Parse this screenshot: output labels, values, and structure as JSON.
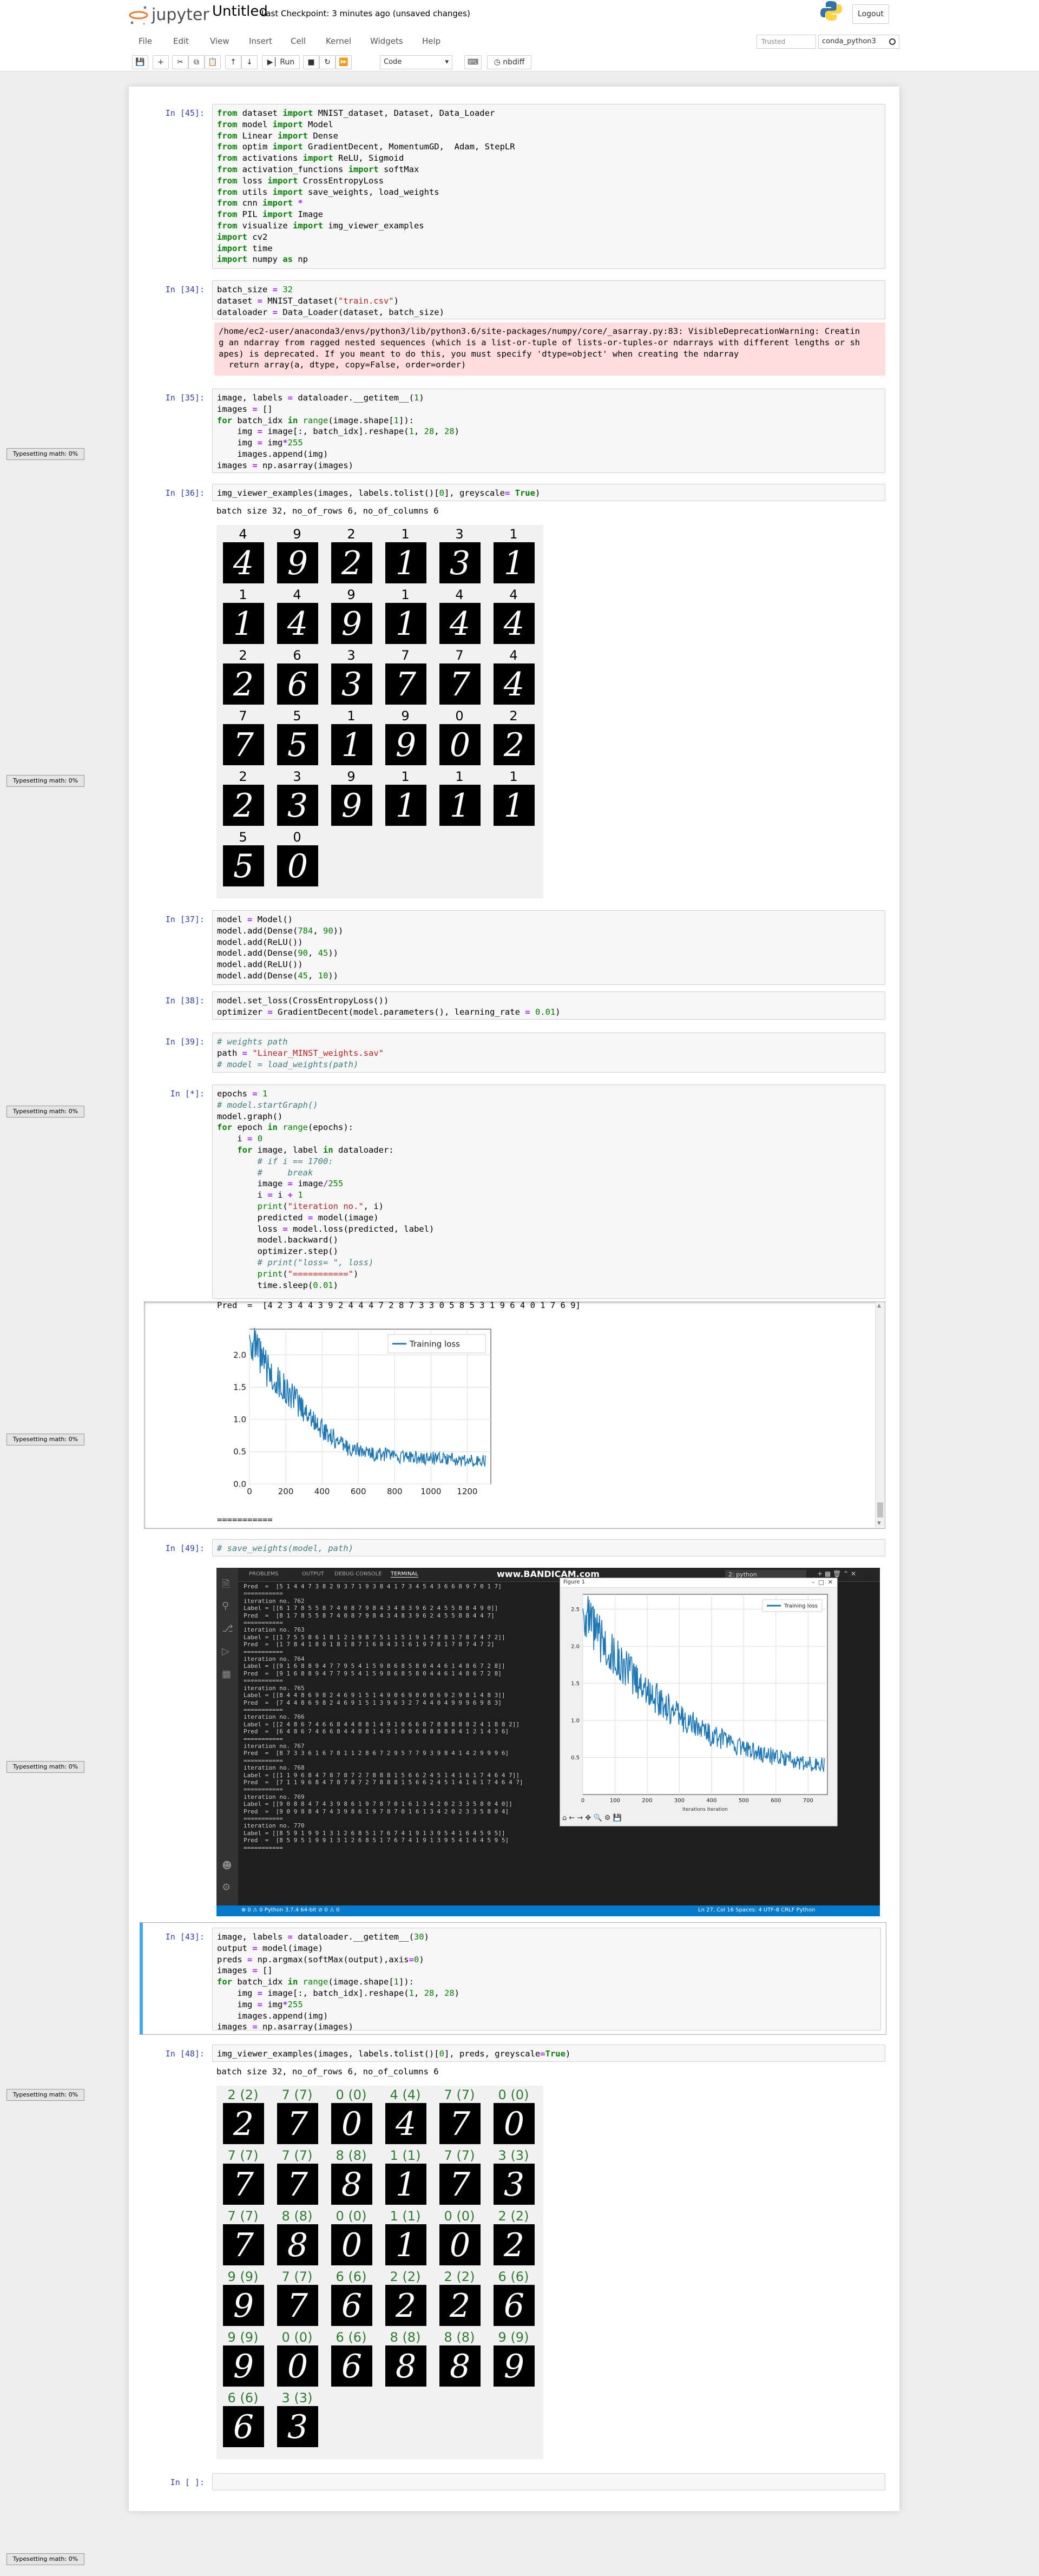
{
  "header": {
    "logo_text": "jupyter",
    "notebook_name": "Untitled",
    "checkpoint": "Last Checkpoint: 3 minutes ago  (unsaved changes)",
    "logout": "Logout",
    "trusted": "Trusted",
    "kernel": "conda_python3",
    "menu": [
      "File",
      "Edit",
      "View",
      "Insert",
      "Cell",
      "Kernel",
      "Widgets",
      "Help"
    ],
    "toolbar": {
      "run": "Run",
      "cell_type": "Code",
      "nbdiff": "nbdiff"
    }
  },
  "typesetting": "Typesetting math: 0%",
  "cells": {
    "c45": {
      "prompt": "In [45]:",
      "code": [
        "from dataset import MNIST_dataset, Dataset, Data_Loader",
        "from model import Model",
        "from Linear import Dense",
        "from optim import GradientDecent, MomentumGD,  Adam, StepLR",
        "from activations import ReLU, Sigmoid",
        "from activation_functions import softMax",
        "from loss import CrossEntropyLoss",
        "from utils import save_weights, load_weights",
        "from cnn import *",
        "from PIL import Image",
        "from visualize import img_viewer_examples",
        "import cv2",
        "import time",
        "import numpy as np"
      ]
    },
    "c34": {
      "prompt": "In [34]:",
      "code": [
        "batch_size = 32",
        "dataset = MNIST_dataset(\"train.csv\")",
        "dataloader = Data_Loader(dataset, batch_size)"
      ],
      "stderr": [
        "/home/ec2-user/anaconda3/envs/python3/lib/python3.6/site-packages/numpy/core/_asarray.py:83: VisibleDeprecationWarning: Creatin",
        "g an ndarray from ragged nested sequences (which is a list-or-tuple of lists-or-tuples-or ndarrays with different lengths or sh",
        "apes) is deprecated. If you meant to do this, you must specify 'dtype=object' when creating the ndarray",
        "  return array(a, dtype, copy=False, order=order)"
      ]
    },
    "c35": {
      "prompt": "In [35]:",
      "code": [
        "image, labels = dataloader.__getitem__(1)",
        "images = []",
        "for batch_idx in range(image.shape[1]):",
        "    img = image[:, batch_idx].reshape(1, 28, 28)",
        "    img = img*255",
        "    images.append(img)",
        "images = np.asarray(images)"
      ]
    },
    "c36": {
      "prompt": "In [36]:",
      "code": [
        "img_viewer_examples(images, labels.tolist()[0], greyscale= True)"
      ],
      "output": "batch size 32, no_of_rows 6, no_of_columns 6",
      "grid": [
        [
          "4",
          "4"
        ],
        [
          "9",
          "9"
        ],
        [
          "2",
          "2"
        ],
        [
          "1",
          "1"
        ],
        [
          "3",
          "3"
        ],
        [
          "1",
          "1"
        ],
        [
          "1",
          "1"
        ],
        [
          "4",
          "4"
        ],
        [
          "9",
          "9"
        ],
        [
          "1",
          "1"
        ],
        [
          "4",
          "4"
        ],
        [
          "4",
          "4"
        ],
        [
          "2",
          "2"
        ],
        [
          "6",
          "6"
        ],
        [
          "3",
          "3"
        ],
        [
          "7",
          "7"
        ],
        [
          "7",
          "7"
        ],
        [
          "4",
          "4"
        ],
        [
          "7",
          "7"
        ],
        [
          "5",
          "5"
        ],
        [
          "1",
          "1"
        ],
        [
          "9",
          "9"
        ],
        [
          "0",
          "0"
        ],
        [
          "2",
          "2"
        ],
        [
          "2",
          "2"
        ],
        [
          "3",
          "3"
        ],
        [
          "9",
          "9"
        ],
        [
          "1",
          "1"
        ],
        [
          "1",
          "1"
        ],
        [
          "1",
          "1"
        ],
        [
          "5",
          "5"
        ],
        [
          "0",
          "0"
        ]
      ]
    },
    "c37": {
      "prompt": "In [37]:",
      "code": [
        "model = Model()",
        "model.add(Dense(784, 90))",
        "model.add(ReLU())",
        "model.add(Dense(90, 45))",
        "model.add(ReLU())",
        "model.add(Dense(45, 10))"
      ]
    },
    "c38": {
      "prompt": "In [38]:",
      "code": [
        "model.set_loss(CrossEntropyLoss())",
        "optimizer = GradientDecent(model.parameters(), learning_rate = 0.01)"
      ]
    },
    "c39": {
      "prompt": "In [39]:",
      "code": [
        "# weights path",
        "path = \"Linear_MINST_weights.sav\"",
        "# model = load_weights(path)"
      ]
    },
    "cstar": {
      "prompt": "In [*]:",
      "code": [
        "epochs = 1",
        "# model.startGraph()",
        "model.graph()",
        "for epoch in range(epochs):",
        "    i = 0",
        "    for image, label in dataloader:",
        "        # if i == 1700:",
        "        #     break",
        "        image = image/255",
        "        i = i + 1",
        "        print(\"iteration no.\", i)",
        "        predicted = model(image)",
        "        loss = model.loss(predicted, label)",
        "        model.backward()",
        "        optimizer.step()",
        "        # print(\"loss= \", loss)",
        "        print(\"===========\")",
        "        time.sleep(0.01)"
      ],
      "out_top": "Pred  =  [4 2 3 4 4 3 9 2 4 4 4 7 2 8 7 3 3 0 5 8 5 3 1 9 6 4 0 1 7 6 9]",
      "out_bottom": "==========="
    },
    "c49": {
      "prompt": "In [49]:",
      "code": [
        "# save_weights(model, path)"
      ]
    },
    "c43": {
      "prompt": "In [43]:",
      "code": [
        "image, labels = dataloader.__getitem__(30)",
        "output = model(image)",
        "preds = np.argmax(softMax(output),axis=0)",
        "images = []",
        "for batch_idx in range(image.shape[1]):",
        "    img = image[:, batch_idx].reshape(1, 28, 28)",
        "    img = img*255",
        "    images.append(img)",
        "images = np.asarray(images)"
      ]
    },
    "c48": {
      "prompt": "In [48]:",
      "code": [
        "img_viewer_examples(images, labels.tolist()[0], preds, greyscale=True)"
      ],
      "output": "batch size 32, no_of_rows 6, no_of_columns 6",
      "grid": [
        [
          "2 (2)",
          "2"
        ],
        [
          "7 (7)",
          "7"
        ],
        [
          "0 (0)",
          "0"
        ],
        [
          "4 (4)",
          "4"
        ],
        [
          "7 (7)",
          "7"
        ],
        [
          "0 (0)",
          "0"
        ],
        [
          "7 (7)",
          "7"
        ],
        [
          "7 (7)",
          "7"
        ],
        [
          "8 (8)",
          "8"
        ],
        [
          "1 (1)",
          "1"
        ],
        [
          "7 (7)",
          "7"
        ],
        [
          "3 (3)",
          "3"
        ],
        [
          "7 (7)",
          "7"
        ],
        [
          "8 (8)",
          "8"
        ],
        [
          "0 (0)",
          "0"
        ],
        [
          "1 (1)",
          "1"
        ],
        [
          "0 (0)",
          "0"
        ],
        [
          "2 (2)",
          "2"
        ],
        [
          "9 (9)",
          "9"
        ],
        [
          "7 (7)",
          "7"
        ],
        [
          "6 (6)",
          "6"
        ],
        [
          "2 (2)",
          "2"
        ],
        [
          "2 (2)",
          "2"
        ],
        [
          "6 (6)",
          "6"
        ],
        [
          "9 (9)",
          "9"
        ],
        [
          "0 (0)",
          "0"
        ],
        [
          "6 (6)",
          "6"
        ],
        [
          "8 (8)",
          "8"
        ],
        [
          "8 (8)",
          "8"
        ],
        [
          "9 (9)",
          "9"
        ],
        [
          "6 (6)",
          "6"
        ],
        [
          "3 (3)",
          "3"
        ]
      ]
    },
    "cempty": {
      "prompt": "In [ ]:"
    }
  },
  "chart_data": [
    {
      "type": "line",
      "title": "",
      "series": [
        {
          "name": "Training loss",
          "color": "#1f77b4"
        }
      ],
      "x": [
        0,
        20,
        40,
        60,
        80,
        100,
        150,
        200,
        250,
        300,
        350,
        400,
        450,
        500,
        550,
        600,
        650,
        700,
        750,
        800,
        850,
        900,
        950,
        1000,
        1050,
        1100,
        1150,
        1200,
        1250,
        1300
      ],
      "y": [
        2.3,
        2.15,
        2.05,
        1.95,
        1.85,
        1.75,
        1.6,
        1.45,
        1.3,
        1.15,
        1.0,
        0.85,
        0.75,
        0.62,
        0.55,
        0.52,
        0.48,
        0.46,
        0.45,
        0.43,
        0.42,
        0.41,
        0.4,
        0.4,
        0.39,
        0.38,
        0.37,
        0.37,
        0.36,
        0.36
      ],
      "xticks": [
        "0",
        "200",
        "400",
        "600",
        "800",
        "1000",
        "1200"
      ],
      "yticks": [
        "0.0",
        "0.5",
        "1.0",
        "1.5",
        "2.0"
      ],
      "xlim": [
        0,
        1330
      ],
      "ylim": [
        0,
        2.4
      ],
      "legend": "top-right",
      "grid": true
    }
  ],
  "screenshot": {
    "watermark": "www.BANDICAM.com",
    "panel_tabs": [
      "PROBLEMS",
      "OUTPUT",
      "DEBUG CONSOLE",
      "TERMINAL"
    ],
    "terminal_select": "2: python",
    "figure_title": "Figure 1",
    "figure_legend": "Training loss",
    "figure_xlabel": "Iterations Iteration",
    "figure_yticks": [
      "0.5",
      "1.0",
      "1.5",
      "2.0",
      "2.5"
    ],
    "figure_xticks": [
      "0",
      "100",
      "200",
      "300",
      "400",
      "500",
      "600",
      "700"
    ],
    "status_left": "⊗ 0 ⚠ 0   Python 3.7.4 64-bit   ⊘ 0 ⚠ 0",
    "status_right": "Ln 27, Col 16   Spaces: 4   UTF-8   CRLF   Python",
    "terminal_lines": [
      "Pred  =  [5 1 4 4 7 3 8 2 9 3 7 1 9 3 8 4 1 7 3 4 5 4 3 6 6 8 9 7 0 1 7]",
      "===========",
      "iteration no. 762",
      "Label = [[6 1 7 8 5 5 8 7 4 0 8 7 9 8 4 3 4 8 3 9 6 2 4 5 5 8 8 4 9 0]]",
      "Pred  =  [8 1 7 8 5 5 8 7 4 0 8 7 9 8 4 3 4 8 3 9 6 2 4 5 5 8 8 4 4 7]",
      "===========",
      "iteration no. 763",
      "Label = [[1 7 5 5 8 6 1 8 1 2 1 9 8 7 5 1 1 5 1 9 1 4 7 8 1 7 8 7 4 7 2]]",
      "Pred  =  [1 7 8 4 1 8 0 1 8 1 8 7 1 6 8 4 3 1 6 1 9 7 8 1 7 8 7 4 7 2]",
      "===========",
      "iteration no. 764",
      "Label = [[9 1 6 8 8 9 4 7 7 9 5 4 1 5 9 8 6 8 5 8 0 4 4 6 1 4 8 6 7 2 8]]",
      "Pred  =  [9 1 6 8 8 9 4 7 7 9 5 4 1 5 9 8 6 8 5 8 0 4 4 6 1 4 8 6 7 2 8]",
      "===========",
      "iteration no. 765",
      "Label = [[8 4 4 8 6 9 8 2 4 6 9 1 5 1 4 9 0 6 9 0 0 0 6 9 2 9 8 1 4 8 3]]",
      "Pred  =  [7 4 4 8 6 9 8 2 4 6 9 1 5 1 3 9 6 3 2 7 4 4 0 4 9 9 9 6 9 8 3]",
      "===========",
      "iteration no. 766",
      "Label = [[2 4 8 6 7 4 6 6 8 4 4 0 8 1 4 9 1 0 6 6 8 7 8 8 8 8 8 2 4 1 8 8 2]]",
      "Pred  =  [6 4 8 6 7 4 6 6 8 4 4 0 8 1 4 9 1 0 0 6 8 8 8 8 8 4 1 2 1 4 3 6]",
      "===========",
      "iteration no. 767",
      "Pred  =  [8 7 3 3 6 1 6 7 8 1 1 2 8 6 7 2 9 5 7 7 9 3 9 8 4 1 4 2 9 9 9 6]",
      "===========",
      "iteration no. 768",
      "Label = [[1 1 9 6 8 4 7 8 7 8 7 2 7 8 8 8 1 5 6 6 2 4 5 1 4 1 6 1 7 4 6 4 7]]",
      "Pred  =  [7 1 1 9 6 8 4 7 8 7 8 7 2 7 8 8 8 1 5 6 6 2 4 5 1 4 1 6 1 7 4 6 4 7]",
      "===========",
      "iteration no. 769",
      "Label = [[9 0 8 8 4 7 4 3 9 8 6 1 9 7 8 7 0 1 6 1 3 4 2 0 2 3 3 5 8 0 4 0]]",
      "Pred  =  [9 0 9 8 8 4 7 4 3 9 8 6 1 9 7 8 7 0 1 6 1 3 4 2 0 2 3 3 5 8 0 4]",
      "===========",
      "iteration no. 770",
      "Label = [[8 5 9 1 9 9 1 3 1 2 6 8 5 1 7 6 7 4 1 9 1 3 9 5 4 1 6 4 5 9 5]]",
      "Pred  =  [8 5 9 5 1 9 9 1 3 1 2 6 8 5 1 7 6 7 4 1 9 1 3 9 5 4 1 6 4 5 9 5]",
      "==========="
    ]
  }
}
